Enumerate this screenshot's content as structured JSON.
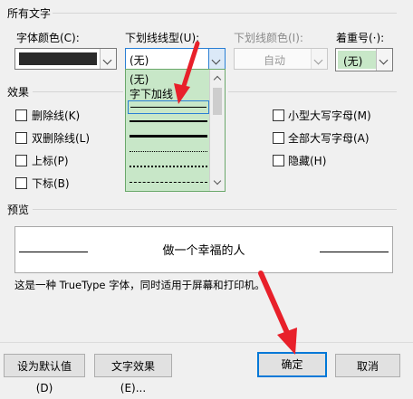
{
  "font_section": {
    "title": "所有文字",
    "font_color_label": "字体颜色(C):",
    "underline_type_label": "下划线线型(U):",
    "underline_type_value": "(无)",
    "underline_color_label": "下划线颜色(I):",
    "underline_color_value": "自动",
    "emphasis_label": "着重号(·):",
    "emphasis_value": "(无)",
    "font_color_swatch": "#2b2b2b"
  },
  "underline_dropdown": {
    "items": [
      "(无)",
      "字下加线"
    ],
    "highlight": "#c8e7c8",
    "selected_border": "#2a7fd4"
  },
  "effects": {
    "title": "效果",
    "left": [
      {
        "label": "删除线(K)"
      },
      {
        "label": "双删除线(L)"
      },
      {
        "label": "上标(P)"
      },
      {
        "label": "下标(B)"
      }
    ],
    "right": [
      {
        "label": "小型大写字母(M)"
      },
      {
        "label": "全部大写字母(A)"
      },
      {
        "label": "隐藏(H)"
      }
    ]
  },
  "preview": {
    "title": "预览",
    "sample_text": "做一个幸福的人",
    "description": "这是一种 TrueType 字体，同时适用于屏幕和打印机。"
  },
  "buttons": {
    "set_default": "设为默认值(D)",
    "text_effects": "文字效果(E)...",
    "ok": "确定",
    "cancel": "取消"
  },
  "colors": {
    "annotation_arrow": "#e8202a",
    "primary_border": "#0078d7"
  }
}
